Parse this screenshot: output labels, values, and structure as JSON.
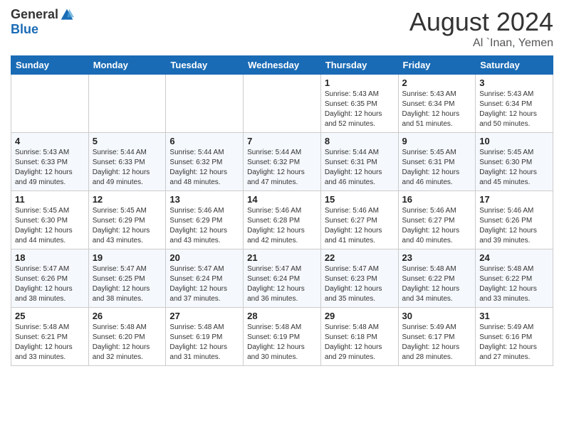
{
  "header": {
    "logo_general": "General",
    "logo_blue": "Blue",
    "month_year": "August 2024",
    "location": "Al `Inan, Yemen"
  },
  "days_of_week": [
    "Sunday",
    "Monday",
    "Tuesday",
    "Wednesday",
    "Thursday",
    "Friday",
    "Saturday"
  ],
  "weeks": [
    [
      {
        "day": "",
        "info": ""
      },
      {
        "day": "",
        "info": ""
      },
      {
        "day": "",
        "info": ""
      },
      {
        "day": "",
        "info": ""
      },
      {
        "day": "1",
        "info": "Sunrise: 5:43 AM\nSunset: 6:35 PM\nDaylight: 12 hours\nand 52 minutes."
      },
      {
        "day": "2",
        "info": "Sunrise: 5:43 AM\nSunset: 6:34 PM\nDaylight: 12 hours\nand 51 minutes."
      },
      {
        "day": "3",
        "info": "Sunrise: 5:43 AM\nSunset: 6:34 PM\nDaylight: 12 hours\nand 50 minutes."
      }
    ],
    [
      {
        "day": "4",
        "info": "Sunrise: 5:43 AM\nSunset: 6:33 PM\nDaylight: 12 hours\nand 49 minutes."
      },
      {
        "day": "5",
        "info": "Sunrise: 5:44 AM\nSunset: 6:33 PM\nDaylight: 12 hours\nand 49 minutes."
      },
      {
        "day": "6",
        "info": "Sunrise: 5:44 AM\nSunset: 6:32 PM\nDaylight: 12 hours\nand 48 minutes."
      },
      {
        "day": "7",
        "info": "Sunrise: 5:44 AM\nSunset: 6:32 PM\nDaylight: 12 hours\nand 47 minutes."
      },
      {
        "day": "8",
        "info": "Sunrise: 5:44 AM\nSunset: 6:31 PM\nDaylight: 12 hours\nand 46 minutes."
      },
      {
        "day": "9",
        "info": "Sunrise: 5:45 AM\nSunset: 6:31 PM\nDaylight: 12 hours\nand 46 minutes."
      },
      {
        "day": "10",
        "info": "Sunrise: 5:45 AM\nSunset: 6:30 PM\nDaylight: 12 hours\nand 45 minutes."
      }
    ],
    [
      {
        "day": "11",
        "info": "Sunrise: 5:45 AM\nSunset: 6:30 PM\nDaylight: 12 hours\nand 44 minutes."
      },
      {
        "day": "12",
        "info": "Sunrise: 5:45 AM\nSunset: 6:29 PM\nDaylight: 12 hours\nand 43 minutes."
      },
      {
        "day": "13",
        "info": "Sunrise: 5:46 AM\nSunset: 6:29 PM\nDaylight: 12 hours\nand 43 minutes."
      },
      {
        "day": "14",
        "info": "Sunrise: 5:46 AM\nSunset: 6:28 PM\nDaylight: 12 hours\nand 42 minutes."
      },
      {
        "day": "15",
        "info": "Sunrise: 5:46 AM\nSunset: 6:27 PM\nDaylight: 12 hours\nand 41 minutes."
      },
      {
        "day": "16",
        "info": "Sunrise: 5:46 AM\nSunset: 6:27 PM\nDaylight: 12 hours\nand 40 minutes."
      },
      {
        "day": "17",
        "info": "Sunrise: 5:46 AM\nSunset: 6:26 PM\nDaylight: 12 hours\nand 39 minutes."
      }
    ],
    [
      {
        "day": "18",
        "info": "Sunrise: 5:47 AM\nSunset: 6:26 PM\nDaylight: 12 hours\nand 38 minutes."
      },
      {
        "day": "19",
        "info": "Sunrise: 5:47 AM\nSunset: 6:25 PM\nDaylight: 12 hours\nand 38 minutes."
      },
      {
        "day": "20",
        "info": "Sunrise: 5:47 AM\nSunset: 6:24 PM\nDaylight: 12 hours\nand 37 minutes."
      },
      {
        "day": "21",
        "info": "Sunrise: 5:47 AM\nSunset: 6:24 PM\nDaylight: 12 hours\nand 36 minutes."
      },
      {
        "day": "22",
        "info": "Sunrise: 5:47 AM\nSunset: 6:23 PM\nDaylight: 12 hours\nand 35 minutes."
      },
      {
        "day": "23",
        "info": "Sunrise: 5:48 AM\nSunset: 6:22 PM\nDaylight: 12 hours\nand 34 minutes."
      },
      {
        "day": "24",
        "info": "Sunrise: 5:48 AM\nSunset: 6:22 PM\nDaylight: 12 hours\nand 33 minutes."
      }
    ],
    [
      {
        "day": "25",
        "info": "Sunrise: 5:48 AM\nSunset: 6:21 PM\nDaylight: 12 hours\nand 33 minutes."
      },
      {
        "day": "26",
        "info": "Sunrise: 5:48 AM\nSunset: 6:20 PM\nDaylight: 12 hours\nand 32 minutes."
      },
      {
        "day": "27",
        "info": "Sunrise: 5:48 AM\nSunset: 6:19 PM\nDaylight: 12 hours\nand 31 minutes."
      },
      {
        "day": "28",
        "info": "Sunrise: 5:48 AM\nSunset: 6:19 PM\nDaylight: 12 hours\nand 30 minutes."
      },
      {
        "day": "29",
        "info": "Sunrise: 5:48 AM\nSunset: 6:18 PM\nDaylight: 12 hours\nand 29 minutes."
      },
      {
        "day": "30",
        "info": "Sunrise: 5:49 AM\nSunset: 6:17 PM\nDaylight: 12 hours\nand 28 minutes."
      },
      {
        "day": "31",
        "info": "Sunrise: 5:49 AM\nSunset: 6:16 PM\nDaylight: 12 hours\nand 27 minutes."
      }
    ]
  ]
}
